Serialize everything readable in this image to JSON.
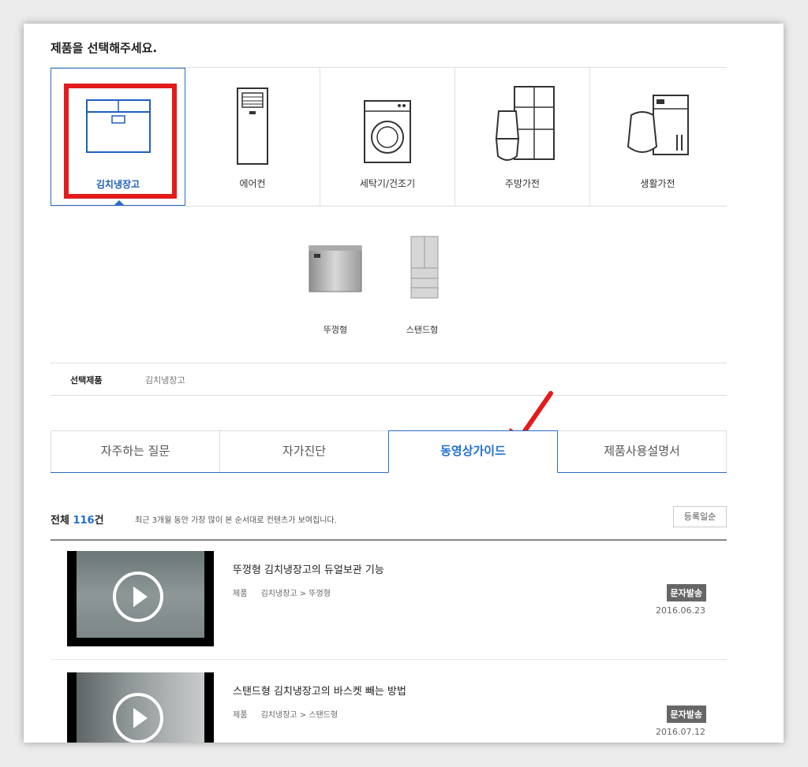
{
  "title": "제품을 선택해주세요.",
  "categories": [
    {
      "label": "김치냉장고",
      "icon": "kimchi-fridge-icon"
    },
    {
      "label": "에어컨",
      "icon": "air-conditioner-icon"
    },
    {
      "label": "세탁기/건조기",
      "icon": "washing-machine-icon"
    },
    {
      "label": "주방가전",
      "icon": "kitchen-appliance-icon"
    },
    {
      "label": "생활가전",
      "icon": "home-appliance-icon"
    }
  ],
  "subcategories": [
    {
      "label": "뚜껑형",
      "icon": "lid-type-fridge-image"
    },
    {
      "label": "스탠드형",
      "icon": "stand-type-fridge-image"
    }
  ],
  "selected": {
    "key": "선택제품",
    "value": "김치냉장고"
  },
  "tabs": [
    {
      "label": "자주하는 질문"
    },
    {
      "label": "자가진단"
    },
    {
      "label": "동영상가이드"
    },
    {
      "label": "제품사용설명서"
    }
  ],
  "active_tab": 2,
  "list": {
    "total_label": "전체",
    "count": "116",
    "count_unit": "건",
    "note": "최근 3개월 동안 가장 많이 본 순서대로 컨텐츠가 보여집니다.",
    "sort_label": "등록일순"
  },
  "items": [
    {
      "title": "뚜껑형 김치냉장고의 듀얼보관 기능",
      "path_key": "제품",
      "path": "김치냉장고 > 뚜껑형",
      "badge": "문자발송",
      "date": "2016.06.23"
    },
    {
      "title": "스탠드형 김치냉장고의 바스켓 빼는 방법",
      "path_key": "제품",
      "path": "김치냉장고 > 스탠드형",
      "badge": "문자발송",
      "date": "2016.07.12"
    }
  ],
  "colors": {
    "accent": "#1f6fd1",
    "highlight": "#e31b1b",
    "badge": "#666666"
  }
}
